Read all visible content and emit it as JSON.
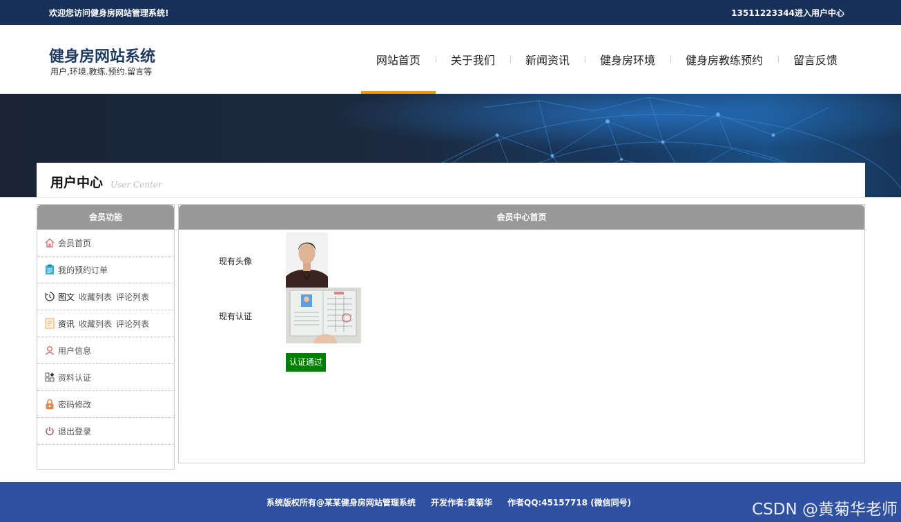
{
  "topbar": {
    "welcome": "欢迎您访问健身房网站管理系统!",
    "user_center": "13511223344进入用户中心"
  },
  "site": {
    "title": "健身房网站系统",
    "subtitle": "用户,环境.教练.预约.留言等"
  },
  "nav": [
    {
      "label": "网站首页",
      "active": true
    },
    {
      "label": "关于我们"
    },
    {
      "label": "新闻资讯"
    },
    {
      "label": "健身房环境"
    },
    {
      "label": "健身房教练预约"
    },
    {
      "label": "留言反馈"
    }
  ],
  "page_title": {
    "cn": "用户中心",
    "en": "User Center"
  },
  "sidebar": {
    "heading": "会员功能",
    "items": [
      {
        "icon": "home-icon",
        "label": "会员首页"
      },
      {
        "icon": "clipboard-icon",
        "label": "我的预约订单"
      },
      {
        "icon": "refresh-icon",
        "label": "图文",
        "links": [
          "收藏列表",
          "评论列表"
        ]
      },
      {
        "icon": "document-icon",
        "label": "资讯",
        "links": [
          "收藏列表",
          "评论列表"
        ]
      },
      {
        "icon": "user-icon",
        "label": "用户信息"
      },
      {
        "icon": "grid-icon",
        "label": "资料认证"
      },
      {
        "icon": "lock-icon",
        "label": "密码修改"
      },
      {
        "icon": "power-icon",
        "label": "退出登录"
      }
    ]
  },
  "main": {
    "heading": "会员中心首页",
    "avatar_label": "现有头像",
    "cert_label": "现有认证",
    "approve_button": "认证通过",
    "approve_color": "#008000"
  },
  "footer": {
    "copyright": "系统版权所有@某某健身房网站管理系统",
    "author": "开发作者:黄菊华",
    "qq": "作者QQ:45157718 (微信同号)"
  },
  "watermark": "CSDN @黄菊华老师",
  "colors": {
    "topbar": "#16305a",
    "accent": "#f39800",
    "footer": "#3050a0",
    "panel_head": "#999999"
  }
}
